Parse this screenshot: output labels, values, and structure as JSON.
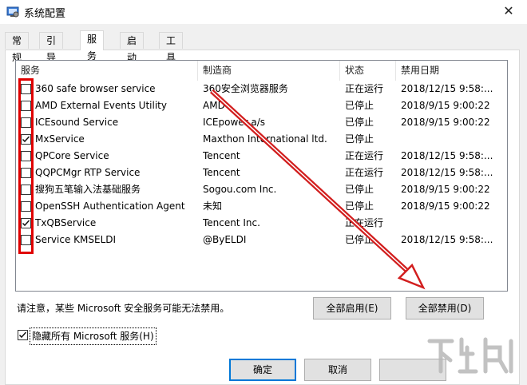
{
  "window": {
    "title": "系统配置",
    "close_glyph": "✕"
  },
  "tabs": [
    {
      "label": "常规"
    },
    {
      "label": "引导"
    },
    {
      "label": "服务"
    },
    {
      "label": "启动"
    },
    {
      "label": "工具"
    }
  ],
  "active_tab": "服务",
  "columns": {
    "service": "服务",
    "manufacturer": "制造商",
    "status": "状态",
    "disabled_date": "禁用日期"
  },
  "rows": [
    {
      "service": "360 safe browser service",
      "manufacturer": "360安全浏览器服务",
      "status": "正在运行",
      "date": "2018/12/15 9:58:...",
      "checked": false
    },
    {
      "service": "AMD External Events Utility",
      "manufacturer": "AMD",
      "status": "已停止",
      "date": "2018/9/15 9:00:22",
      "checked": false
    },
    {
      "service": "ICEsound Service",
      "manufacturer": "ICEpower a/s",
      "status": "已停止",
      "date": "2018/9/15 9:00:22",
      "checked": false
    },
    {
      "service": "MxService",
      "manufacturer": "Maxthon International ltd.",
      "status": "已停止",
      "date": "",
      "checked": true
    },
    {
      "service": "QPCore Service",
      "manufacturer": "Tencent",
      "status": "正在运行",
      "date": "2018/12/15 9:58:...",
      "checked": false
    },
    {
      "service": "QQPCMgr RTP Service",
      "manufacturer": "Tencent",
      "status": "正在运行",
      "date": "2018/12/15 9:58:...",
      "checked": false
    },
    {
      "service": "搜狗五笔输入法基础服务",
      "manufacturer": "Sogou.com Inc.",
      "status": "已停止",
      "date": "2018/9/15 9:00:22",
      "checked": false
    },
    {
      "service": "OpenSSH Authentication Agent",
      "manufacturer": "未知",
      "status": "已停止",
      "date": "2018/9/15 9:00:22",
      "checked": false
    },
    {
      "service": "TxQBService",
      "manufacturer": "Tencent Inc.",
      "status": "正在运行",
      "date": "",
      "checked": true
    },
    {
      "service": "Service KMSELDI",
      "manufacturer": "@ByELDI",
      "status": "已停止",
      "date": "2018/12/15 9:58:...",
      "checked": false
    }
  ],
  "note": "请注意，某些 Microsoft 安全服务可能无法禁用。",
  "buttons": {
    "enable_all": "全部启用(E)",
    "disable_all": "全部禁用(D)",
    "ok": "确定",
    "cancel": "取消"
  },
  "hide_ms": {
    "label": "隐藏所有 Microsoft 服务(H)",
    "checked": true
  },
  "colors": {
    "annotation_red": "#e00000",
    "focus_blue": "#0078d7"
  },
  "watermark": "下载吧"
}
